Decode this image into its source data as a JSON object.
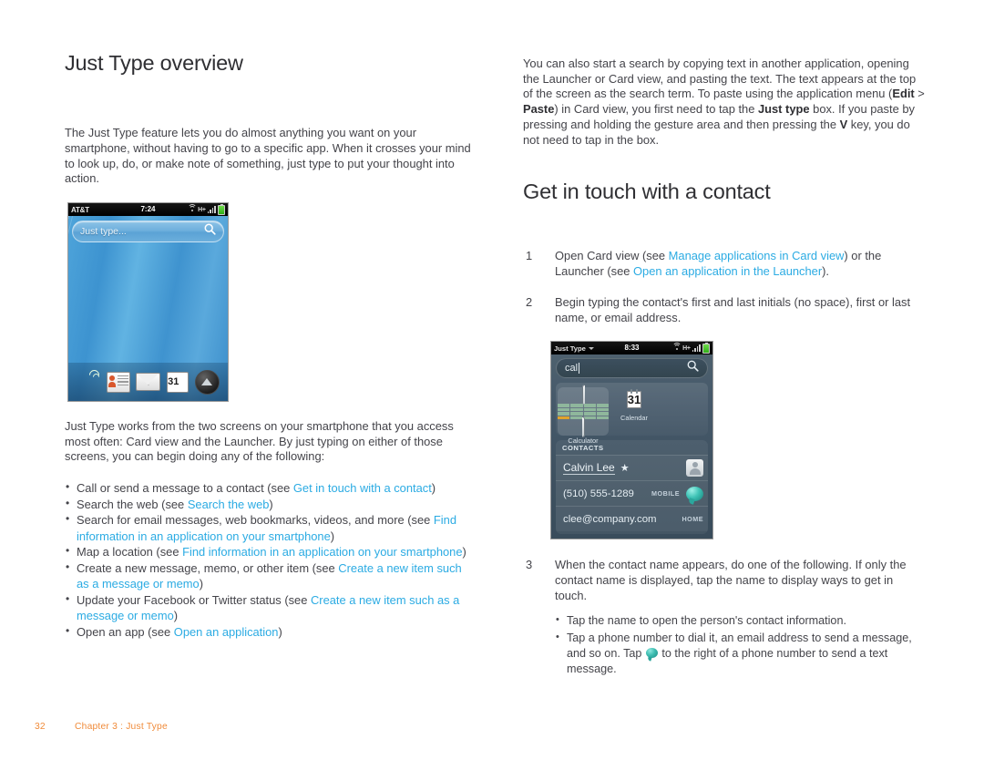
{
  "colors": {
    "link": "#2babe3",
    "body_text": "#44444a",
    "heading": "#2f2f33",
    "footer": "#f08b3a"
  },
  "left_column": {
    "heading": "Just Type overview",
    "intro_paragraph": "The Just Type feature lets you do almost anything you want on your smartphone, without having to go to a specific app. When it crosses your mind to look up, do, or make note of something, just type to put your thought into action.",
    "second_paragraph": "Just Type works from the two screens on your smartphone that you access most often: Card view and the Launcher. By just typing on either of those screens, you can begin doing any of the following:",
    "bullets": [
      {
        "pre": "Call or send a message to a contact (see ",
        "link": "Get in touch with a contact",
        "post": ")"
      },
      {
        "pre": "Search the web (see ",
        "link": "Search the web",
        "post": ")"
      },
      {
        "pre": "Search for email messages, web bookmarks, videos, and more (see ",
        "link": "Find information in an application on your smartphone",
        "post": ")"
      },
      {
        "pre": "Map a location (see ",
        "link": "Find information in an application on your smartphone",
        "post": ")"
      },
      {
        "pre": "Create a new message, memo, or other item (see ",
        "link": "Create a new item such as a message or memo",
        "post": ")"
      },
      {
        "pre": "Update your Facebook or Twitter status (see ",
        "link": "Create a new item such as a message or memo",
        "post": ")"
      },
      {
        "pre": "Open an app (see ",
        "link": "Open an application",
        "post": ")"
      }
    ]
  },
  "right_column": {
    "intro_segments": [
      {
        "text": "You can also start a search by copying text in another application, opening the Launcher or Card view, and pasting the text. The text appears at the top of the screen as the search term. To paste using the application menu (",
        "style": "normal"
      },
      {
        "text": "Edit",
        "style": "bold"
      },
      {
        "text": " > ",
        "style": "normal"
      },
      {
        "text": "Paste",
        "style": "bold"
      },
      {
        "text": ") in Card view, you first need to tap the ",
        "style": "normal"
      },
      {
        "text": "Just type",
        "style": "bold"
      },
      {
        "text": " box. If you paste by pressing and holding the gesture area and then pressing the ",
        "style": "normal"
      },
      {
        "text": "V",
        "style": "bold"
      },
      {
        "text": " key, you do not need to tap in the box.",
        "style": "normal"
      }
    ],
    "heading": "Get in touch with a contact",
    "steps": [
      {
        "number": "1",
        "segments": [
          {
            "text": "Open Card view (see ",
            "style": "normal"
          },
          {
            "text": "Manage applications in Card view",
            "style": "link"
          },
          {
            "text": ") or the Launcher (see ",
            "style": "normal"
          },
          {
            "text": "Open an application in the Launcher",
            "style": "link"
          },
          {
            "text": ").",
            "style": "normal"
          }
        ]
      },
      {
        "number": "2",
        "segments": [
          {
            "text": "Begin typing the contact's first and last initials (no space), first or last name, or email address.",
            "style": "normal"
          }
        ]
      },
      {
        "number": "3",
        "segments": [
          {
            "text": "When the contact name appears, do one of the following. If only the contact name is displayed, tap the name to display ways to get in touch.",
            "style": "normal"
          }
        ],
        "substeps": [
          {
            "pre": "Tap the name to open the person's contact information.",
            "icon": null,
            "post": ""
          },
          {
            "pre": "Tap a phone number to dial it, an email address to send a message, and so on. Tap ",
            "icon": "speech-bubble-icon",
            "post": " to the right of a phone number to send a text message."
          }
        ]
      }
    ]
  },
  "phone_screenshot_1": {
    "status_bar": {
      "carrier": "AT&T",
      "time": "7:24",
      "network": "H+",
      "icons": [
        "wifi-icon",
        "network-hplus-icon",
        "signal-bars-icon",
        "battery-icon"
      ]
    },
    "search_placeholder": "Just type...",
    "search_icon": "search-icon",
    "dock_icons": [
      {
        "name": "phone-icon",
        "label": "Phone"
      },
      {
        "name": "contacts-icon",
        "label": "Contacts"
      },
      {
        "name": "email-icon",
        "label": "Email"
      },
      {
        "name": "calendar-icon",
        "label": "Calendar",
        "day": "31"
      },
      {
        "name": "launcher-icon",
        "label": "Launcher"
      }
    ]
  },
  "phone_screenshot_2": {
    "status_bar": {
      "app_name": "Just Type",
      "time": "8:33",
      "network": "H+",
      "icons": [
        "wifi-icon",
        "network-hplus-icon",
        "signal-bars-icon",
        "battery-icon"
      ]
    },
    "search_value": "cal",
    "search_icon": "search-icon",
    "apps": [
      {
        "name": "calculator-icon",
        "label": "Calculator",
        "selected": true
      },
      {
        "name": "calendar-icon",
        "label": "Calendar",
        "day": "31",
        "selected": false
      }
    ],
    "contacts_section_header": "CONTACTS",
    "contact_rows": [
      {
        "type": "name",
        "value": "Calvin Lee",
        "starred": true,
        "star": "★",
        "tag": "",
        "action": "avatar-icon"
      },
      {
        "type": "phone",
        "value": "(510) 555-1289",
        "tag": "MOBILE",
        "action": "message-bubble-icon"
      },
      {
        "type": "email",
        "value": "clee@company.com",
        "tag": "HOME",
        "action": ""
      }
    ]
  },
  "footer": {
    "page_number": "32",
    "chapter": "Chapter 3  :  Just Type"
  }
}
